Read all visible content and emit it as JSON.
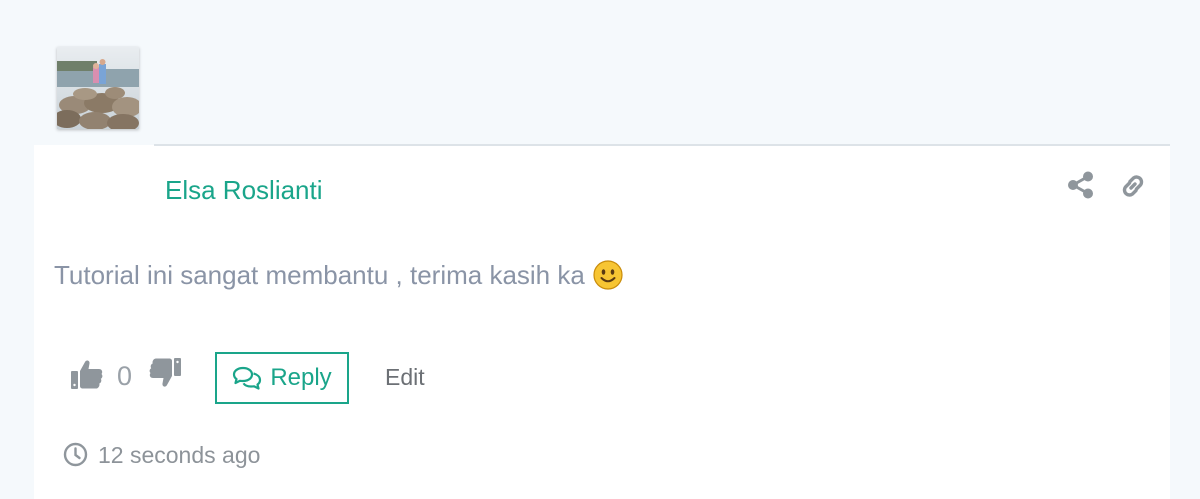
{
  "comment": {
    "author": "Elsa Roslianti",
    "text": "Tutorial ini sangat membantu , terima kasih ka",
    "emoji_icon": "smiley-face-icon",
    "vote_count": "0",
    "reply_label": "Reply",
    "edit_label": "Edit",
    "timestamp": "12 seconds ago"
  },
  "icons": {
    "share": "share-icon",
    "link": "link-icon",
    "like": "thumbs-up-icon",
    "dislike": "thumbs-down-icon",
    "reply": "comments-icon",
    "time": "clock-icon"
  },
  "colors": {
    "accent": "#1aa58a",
    "text_muted": "#8a94a6",
    "icon_gray": "#8f969c",
    "background": "#f5f9fc",
    "card": "#ffffff"
  }
}
